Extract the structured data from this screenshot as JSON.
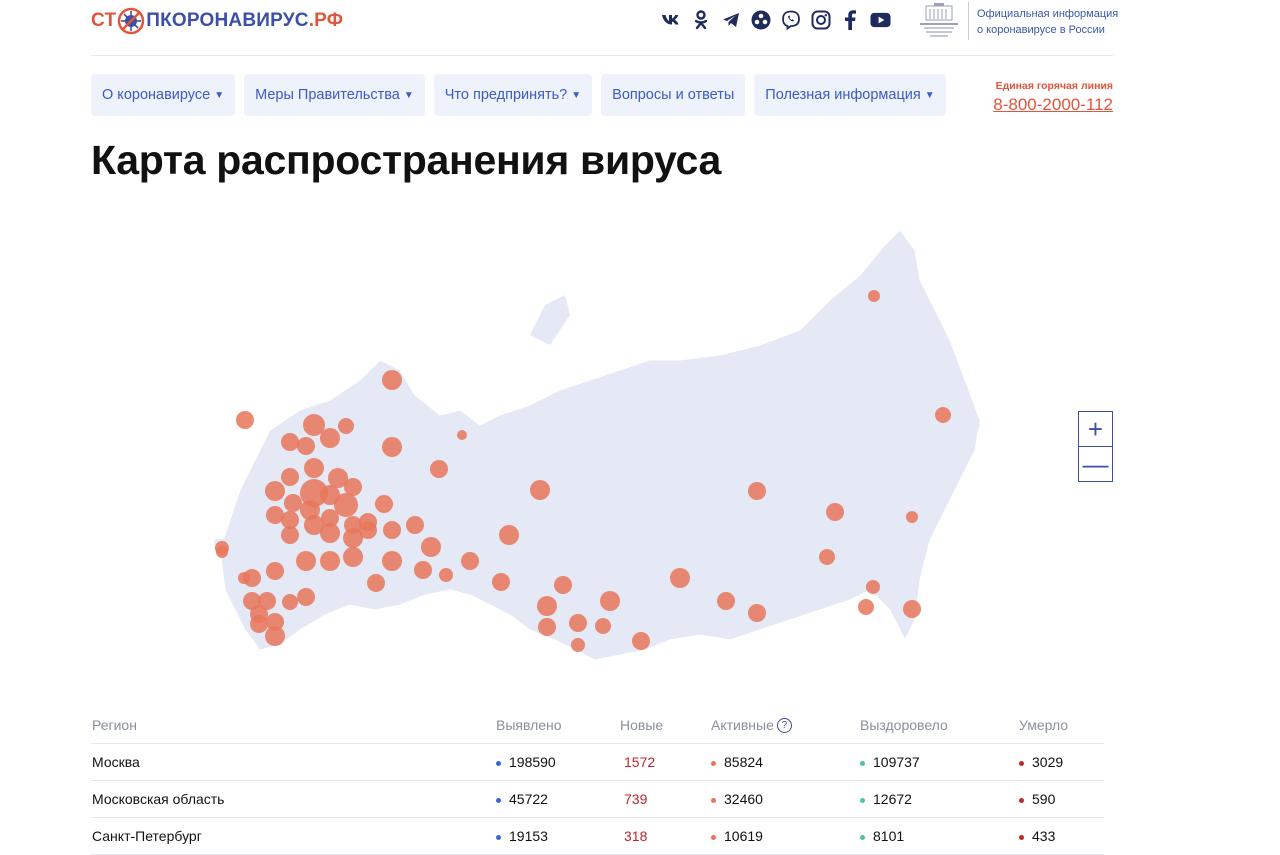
{
  "logo": {
    "st": "СТ",
    "rest": "ПКОРОНАВИРУС",
    "rf": ".РФ"
  },
  "social": [
    {
      "name": "vk-icon",
      "glyph": "vk"
    },
    {
      "name": "odnoklassniki-icon",
      "glyph": "ok"
    },
    {
      "name": "telegram-icon",
      "glyph": "tg"
    },
    {
      "name": "livejournal-icon",
      "glyph": "lj"
    },
    {
      "name": "viber-icon",
      "glyph": "vb"
    },
    {
      "name": "instagram-icon",
      "glyph": "ig"
    },
    {
      "name": "facebook-icon",
      "glyph": "f"
    },
    {
      "name": "youtube-icon",
      "glyph": "yt"
    }
  ],
  "gov": {
    "line1": "Официальная информация",
    "line2": "о коронавирусе в России"
  },
  "nav": [
    {
      "label": "О коронавирусе",
      "dropdown": true
    },
    {
      "label": "Меры Правительства",
      "dropdown": true
    },
    {
      "label": "Что предпринять?",
      "dropdown": true
    },
    {
      "label": "Вопросы и ответы",
      "dropdown": false
    },
    {
      "label": "Полезная информация",
      "dropdown": true
    }
  ],
  "hotline": {
    "label": "Единая горячая линия",
    "phone": "8-800-2000-112"
  },
  "page_title": "Карта распространения вируса",
  "zoom": {
    "in": "+",
    "out": "—"
  },
  "colors": {
    "accent": "#e2553d",
    "brand": "#3b50a6",
    "map_land": "#e5e8f5",
    "bubble": "#e8755a"
  },
  "table": {
    "headers": {
      "region": "Регион",
      "detected": "Выявлено",
      "new": "Новые",
      "active": "Активные",
      "recovered": "Выздоровело",
      "died": "Умерло"
    },
    "help": "?",
    "rows": [
      {
        "region": "Москва",
        "detected": "198590",
        "new": "1572",
        "active": "85824",
        "recovered": "109737",
        "died": "3029"
      },
      {
        "region": "Московская область",
        "detected": "45722",
        "new": "739",
        "active": "32460",
        "recovered": "12672",
        "died": "590"
      },
      {
        "region": "Санкт-Петербург",
        "detected": "19153",
        "new": "318",
        "active": "10619",
        "recovered": "8101",
        "died": "433"
      }
    ]
  }
}
